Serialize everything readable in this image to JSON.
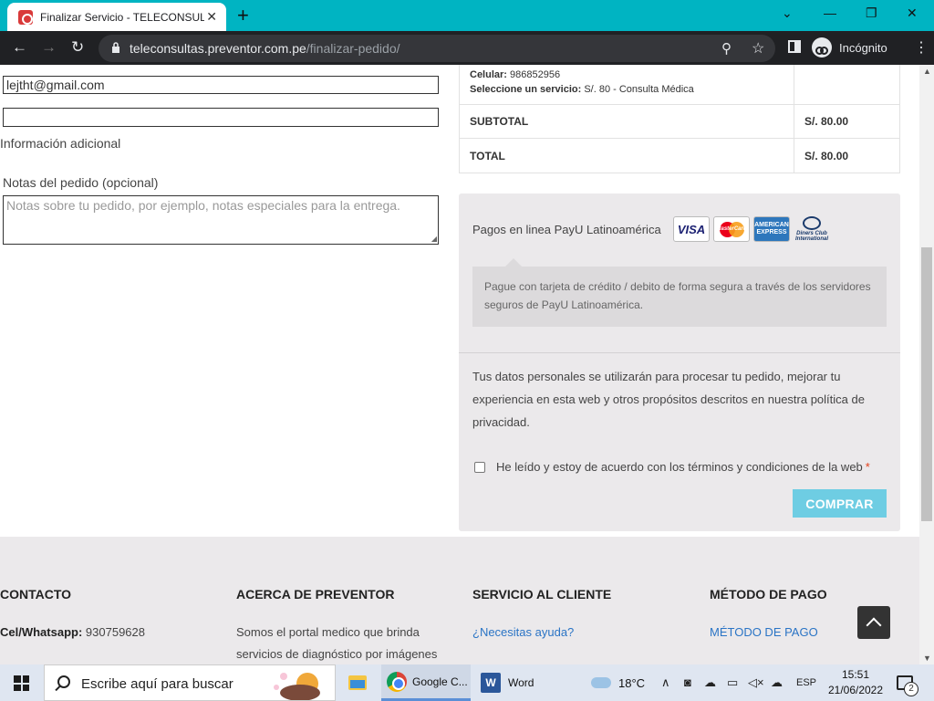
{
  "browser": {
    "tab_title": "Finalizar Servicio - TELECONSULTAS",
    "tab_close": "✕",
    "new_tab": "+",
    "url_domain": "teleconsultas.preventor.com.pe",
    "url_path": "/finalizar-pedido/",
    "incognito_label": "Incógnito"
  },
  "form": {
    "email_value": "lejtht@gmail.com",
    "empty_value": "",
    "additional_info_label": "Información adicional",
    "notes_label": "Notas del pedido (opcional)",
    "notes_placeholder": "Notas sobre tu pedido, por ejemplo, notas especiales para la entrega."
  },
  "order": {
    "phone_label": "Celular:",
    "phone_value": "986852956",
    "service_label": "Seleccione un servicio:",
    "service_value": "S/. 80 - Consulta Médica",
    "subtotal_label": "SUBTOTAL",
    "subtotal_value": "S/. 80.00",
    "total_label": "TOTAL",
    "total_value": "S/. 80.00"
  },
  "payment": {
    "method_label": "Pagos en linea PayU Latinoamérica",
    "cards": [
      "VISA",
      "MasterCard",
      "AMERICAN EXPRESS",
      "Diners Club International"
    ],
    "description": "Pague con tarjeta de crédito / debito de forma segura a través de los servidores seguros de PayU Latinoamérica.",
    "privacy_text": "Tus datos personales se utilizarán para procesar tu pedido, mejorar tu experiencia en esta web y otros propósitos descritos en nuestra política de privacidad.",
    "terms_label": "He leído y estoy de acuerdo con los términos y condiciones de la web",
    "required_mark": "*",
    "buy_button": "COMPRAR",
    "buy_color": "#6ecde3"
  },
  "footer": {
    "contact_heading": "CONTACTO",
    "contact_label": "Cel/Whatsapp:",
    "contact_value": "930759628",
    "about_heading": "ACERCA DE PREVENTOR",
    "about_text": "Somos el portal medico que brinda servicios de diagnóstico por imágenes",
    "service_heading": "SERVICIO AL CLIENTE",
    "service_link": "¿Necesitas ayuda?",
    "payment_heading": "MÉTODO DE PAGO",
    "payment_link": "MÉTODO DE PAGO"
  },
  "taskbar": {
    "search_placeholder": "Escribe aquí para buscar",
    "chrome_label": "Google C...",
    "word_label": "Word",
    "temperature": "18°C",
    "language": "ESP",
    "time": "15:51",
    "date": "21/06/2022",
    "notifications": "2"
  },
  "colors": {
    "tab_bar": "#00b4c2",
    "toolbar": "#202124",
    "link": "#2a74c5",
    "panel": "#ebe9eb"
  }
}
